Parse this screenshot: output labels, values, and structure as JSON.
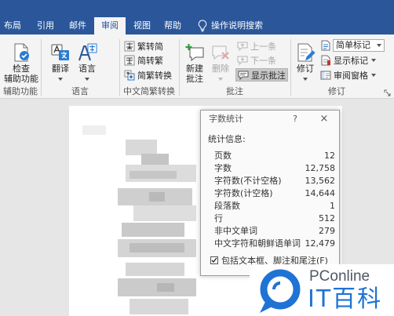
{
  "tabs": [
    {
      "label": "布局"
    },
    {
      "label": "引用"
    },
    {
      "label": "邮件"
    },
    {
      "label": "审阅",
      "active": true
    },
    {
      "label": "视图"
    },
    {
      "label": "帮助"
    }
  ],
  "search": {
    "label": "操作说明搜索",
    "icon": "lightbulb-icon"
  },
  "ribbon": {
    "accessibility": {
      "group_label": "辅助功能",
      "check_line1": "检查",
      "check_line2": "辅助功能",
      "icon": "accessibility-check-icon"
    },
    "language": {
      "group_label": "语言",
      "translate": "翻译",
      "language": "语言",
      "translate_icon": "translate-icon",
      "language_icon": "language-icon"
    },
    "chinese_conversion": {
      "group_label": "中文简繁转换",
      "items": [
        {
          "label": "繁转简",
          "icon": "traditional-to-simplified-icon"
        },
        {
          "label": "简转繁",
          "icon": "simplified-to-traditional-icon"
        },
        {
          "label": "简繁转换",
          "icon": "chinese-conversion-icon"
        }
      ]
    },
    "comments": {
      "group_label": "批注",
      "new_line1": "新建",
      "new_line2": "批注",
      "delete": "删除",
      "previous": "上一条",
      "next": "下一条",
      "show": "显示批注",
      "delete_disabled": true,
      "previous_disabled": true,
      "next_disabled": true,
      "show_pressed": true
    },
    "tracking": {
      "group_label": "修订",
      "track_changes": "修订",
      "markup_mode": "简单标记",
      "show_markup": "显示标记",
      "review_pane": "审阅窗格"
    }
  },
  "dialog": {
    "title": "字数统计",
    "help_label": "?",
    "close_label": "×",
    "section_label": "统计信息:",
    "rows": [
      {
        "label": "页数",
        "value": "12"
      },
      {
        "label": "字数",
        "value": "12,758"
      },
      {
        "label": "字符数(不计空格)",
        "value": "13,562"
      },
      {
        "label": "字符数(计空格)",
        "value": "14,644"
      },
      {
        "label": "段落数",
        "value": "1"
      },
      {
        "label": "行",
        "value": "512"
      },
      {
        "label": "非中文单词",
        "value": "279"
      },
      {
        "label": "中文字符和朝鲜语单词",
        "value": "12,479"
      }
    ],
    "include_textboxes": {
      "label": "包括文本框、脚注和尾注(F)",
      "checked": true
    }
  },
  "watermark": {
    "brand": "PConline",
    "product": "IT百科",
    "logo_icon": "pconline-logo-icon"
  },
  "colors": {
    "title_bar": "#2b579a",
    "ribbon_bg": "#f4f4f4",
    "new_comment_plus": "#2e9e45",
    "watermark_blue": "#1f73d4"
  }
}
